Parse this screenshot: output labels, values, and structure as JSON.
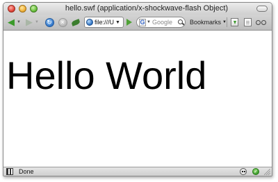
{
  "window": {
    "title": "hello.swf (application/x-shockwave-flash Object)"
  },
  "toolbar": {
    "back_icon": "back-arrow-icon",
    "forward_icon": "forward-arrow-icon",
    "reload_icon": "reload-icon",
    "stop_icon": "stop-icon",
    "url": "file:///U",
    "search": {
      "engine": "Google",
      "placeholder": "Google"
    },
    "bookmarks_label": "Bookmarks"
  },
  "content": {
    "text": "Hello World"
  },
  "statusbar": {
    "text": "Done"
  },
  "colors": {
    "accent_green": "#3a9a2a",
    "reload_blue": "#2f74c8"
  }
}
